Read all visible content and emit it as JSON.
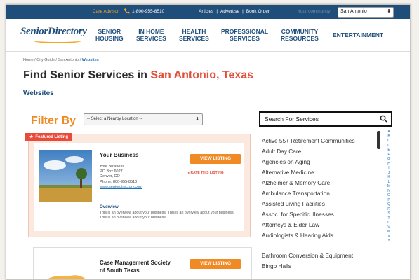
{
  "topbar": {
    "care_advisor": "Care Advisor",
    "phone": "1-800-955-8510",
    "links": [
      "Articles",
      "Advertise",
      "Book Order"
    ],
    "separator": "|",
    "community_label": "Your community:",
    "city_select": "San Antonio"
  },
  "nav": {
    "logo": "SeniorDirectory",
    "items": [
      {
        "line1": "SENIOR",
        "line2": "HOUSING"
      },
      {
        "line1": "IN HOME",
        "line2": "SERVICES"
      },
      {
        "line1": "HEALTH",
        "line2": "SERVICES"
      },
      {
        "line1": "PROFESSIONAL",
        "line2": "SERVICES"
      },
      {
        "line1": "COMMUNITY",
        "line2": "RESOURCES"
      },
      {
        "line1": "ENTERTAINMENT",
        "line2": ""
      }
    ]
  },
  "breadcrumb": {
    "prefix": "Home / City Guide / San Antonio / ",
    "current": "Websites"
  },
  "page": {
    "title_prefix": "Find Senior Services in ",
    "title_city": "San Antonio, Texas",
    "subtitle": "Websites"
  },
  "filter": {
    "label": "Filter By",
    "location_placeholder": "-- Select a Nearby Location --"
  },
  "search": {
    "label": "Search For Services"
  },
  "services": [
    "Active 55+ Retirement Communities",
    "Adult Day Care",
    "Agencies on Aging",
    "Alternative Medicine",
    "Alzheimer & Memory Care",
    "Ambulance Transportation",
    "Assisted Living Facilities",
    "Assoc. for Specific Illnesses",
    "Attorneys & Elder Law",
    "Audiologists & Hearing Aids"
  ],
  "services_b": [
    "Bathroom Conversion & Equipment",
    "Bingo Halls"
  ],
  "alphabet": [
    "A",
    "B",
    "C",
    "D",
    "E",
    "F",
    "G",
    "H",
    "I",
    "J",
    "K",
    "L",
    "M",
    "N",
    "O",
    "P",
    "Q",
    "R",
    "S",
    "T",
    "U",
    "V",
    "W",
    "X",
    "Y"
  ],
  "listing": {
    "badge": "Featured Listing",
    "name": "Your Business",
    "addr1": "Your Business",
    "addr2": "PO Box 6027",
    "addr3": "Denver, CO",
    "phone": "Phone: 800-955-8510",
    "url": "www.seniordirectory.com",
    "view_button": "VIEW LISTING",
    "rate": "RATE THIS LISTING",
    "overview_heading": "Overview",
    "overview": "This is an overview about your business. This is an overview about your business. This is an overview about your business."
  },
  "listing2": {
    "name_line1": "Case Management Society",
    "name_line2": "of South Texas",
    "view_button": "VIEW LISTING"
  },
  "colors": {
    "brand": "#1f4e7b",
    "accent": "#f08a24",
    "city": "#e0503a"
  }
}
